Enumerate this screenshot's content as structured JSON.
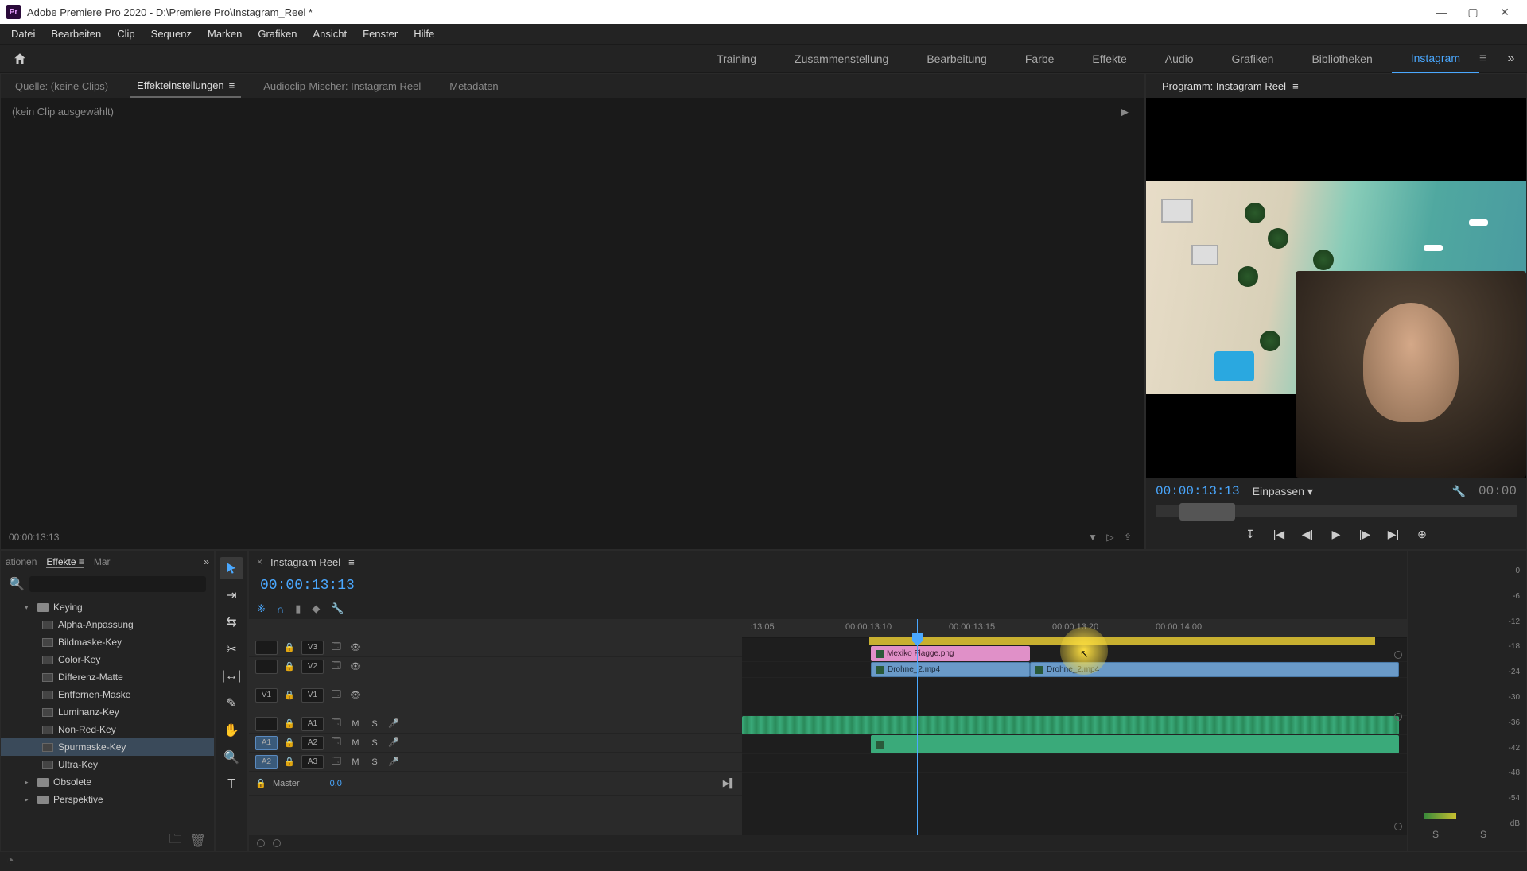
{
  "titlebar": {
    "app": "Adobe Premiere Pro 2020",
    "path": "D:\\Premiere Pro\\Instagram_Reel *",
    "pr": "Pr"
  },
  "menu": [
    "Datei",
    "Bearbeiten",
    "Clip",
    "Sequenz",
    "Marken",
    "Grafiken",
    "Ansicht",
    "Fenster",
    "Hilfe"
  ],
  "workspaces": {
    "items": [
      "Training",
      "Zusammenstellung",
      "Bearbeitung",
      "Farbe",
      "Effekte",
      "Audio",
      "Grafiken",
      "Bibliotheken",
      "Instagram"
    ],
    "active": "Instagram"
  },
  "source": {
    "tabs": [
      "Quelle: (keine Clips)",
      "Effekteinstellungen",
      "Audioclip-Mischer: Instagram Reel",
      "Metadaten"
    ],
    "active": "Effekteinstellungen",
    "noclip": "(kein Clip ausgewählt)",
    "tc": "00:00:13:13"
  },
  "program": {
    "title": "Programm: Instagram Reel",
    "tc": "00:00:13:13",
    "fit": "Einpassen",
    "dur": "00:00"
  },
  "project": {
    "tabs": [
      "ationen",
      "Effekte",
      "Mar"
    ],
    "active": "Effekte",
    "search_placeholder": ""
  },
  "tree": {
    "folder_keying": "Keying",
    "items": [
      "Alpha-Anpassung",
      "Bildmaske-Key",
      "Color-Key",
      "Differenz-Matte",
      "Entfernen-Maske",
      "Luminanz-Key",
      "Non-Red-Key",
      "Spurmaske-Key",
      "Ultra-Key"
    ],
    "selected": "Spurmaske-Key",
    "folder_obsolete": "Obsolete",
    "folder_perspektive": "Perspektive"
  },
  "timeline": {
    "title": "Instagram Reel",
    "tc": "00:00:13:13",
    "ruler": [
      ":13:05",
      "00:00:13:10",
      "00:00:13:15",
      "00:00:13:20",
      "00:00:14:00"
    ],
    "tracks": {
      "v3": "V3",
      "v2": "V2",
      "v1_src": "V1",
      "v1": "V1",
      "a1": "A1",
      "a2": "A2",
      "a3": "A3",
      "master": "Master",
      "master_val": "0,0",
      "m": "M",
      "s": "S"
    },
    "clips": {
      "flag": "Mexiko Flagge.png",
      "drone1": "Drohne_2.mp4",
      "drone2": "Drohne_2.mp4"
    }
  },
  "meters": {
    "scale": [
      "0",
      "-6",
      "-12",
      "-18",
      "-24",
      "-30",
      "-36",
      "-42",
      "-48",
      "-54",
      "dB"
    ],
    "s": "S"
  }
}
